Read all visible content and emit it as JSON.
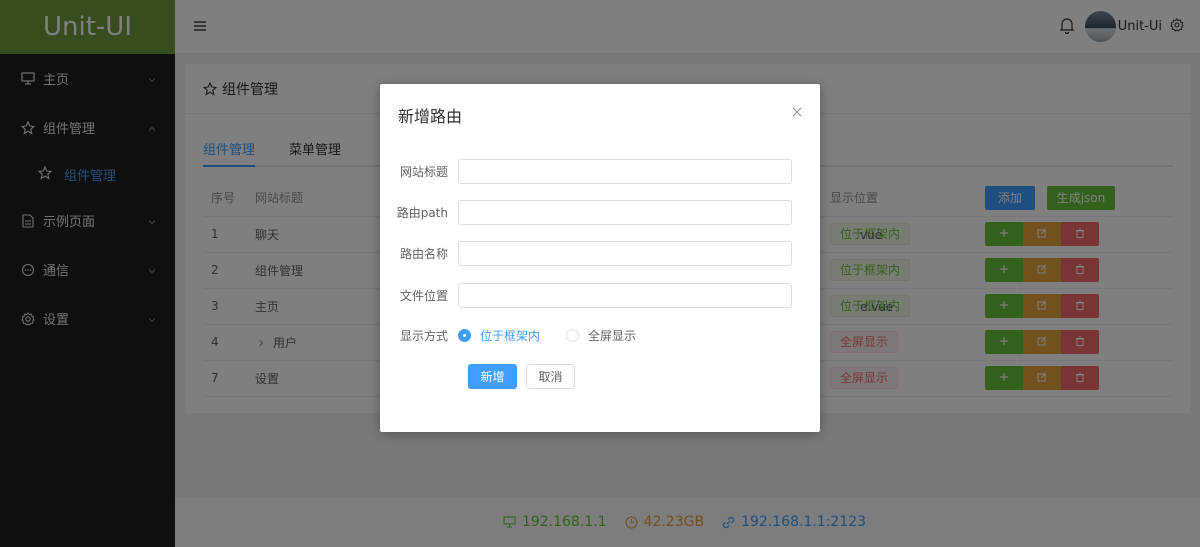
{
  "app": {
    "logo_text": "Unit-UI"
  },
  "sidebar": {
    "items": [
      {
        "label": "主页",
        "icon": "monitor-icon"
      },
      {
        "label": "组件管理",
        "icon": "star-icon",
        "expanded": true
      },
      {
        "label": "示例页面",
        "icon": "document-icon"
      },
      {
        "label": "通信",
        "icon": "chat-icon"
      },
      {
        "label": "设置",
        "icon": "gear-icon"
      }
    ],
    "subitems": [
      {
        "label": "组件管理",
        "icon": "star-icon",
        "active": true
      }
    ]
  },
  "header": {
    "user_name": "Unit-Ui"
  },
  "card": {
    "title": "组件管理",
    "tabs": [
      {
        "label": "组件管理",
        "active": true
      },
      {
        "label": "菜单管理",
        "active": false
      }
    ]
  },
  "table": {
    "headers": {
      "index": "序号",
      "title": "网站标题",
      "position": "显示位置"
    },
    "add_button": "添加",
    "json_button": "生成json",
    "rows": [
      {
        "index": "1",
        "title": "聊天",
        "file": "vue",
        "position": "位于框架内",
        "position_type": "green"
      },
      {
        "index": "2",
        "title": "组件管理",
        "file": "",
        "position": "位于框架内",
        "position_type": "green"
      },
      {
        "index": "3",
        "title": "主页",
        "file": "e.vue",
        "position": "位于框架内",
        "position_type": "green"
      },
      {
        "index": "4",
        "title": "用户",
        "file": "",
        "position": "全屏显示",
        "position_type": "red"
      },
      {
        "index": "7",
        "title": "设置",
        "file": "",
        "position": "全屏显示",
        "position_type": "red"
      }
    ]
  },
  "footer": {
    "ip": "192.168.1.1",
    "storage": "42.23GB",
    "link": "192.168.1.1:2123"
  },
  "dialog": {
    "title": "新增路由",
    "fields": [
      {
        "label": "网站标题",
        "value": ""
      },
      {
        "label": "路由path",
        "value": ""
      },
      {
        "label": "路由名称",
        "value": ""
      },
      {
        "label": "文件位置",
        "value": ""
      }
    ],
    "display_label": "显示方式",
    "radio_options": [
      {
        "label": "位于框架内",
        "checked": true
      },
      {
        "label": "全屏显示",
        "checked": false
      }
    ],
    "submit_label": "新增",
    "cancel_label": "取消"
  },
  "colors": {
    "primary": "#409eff",
    "success": "#67c23a",
    "warning": "#e6a23c",
    "danger": "#f56c6c",
    "logo_bg": "#6f9a3b",
    "sidebar_bg": "#1e1e1e"
  }
}
